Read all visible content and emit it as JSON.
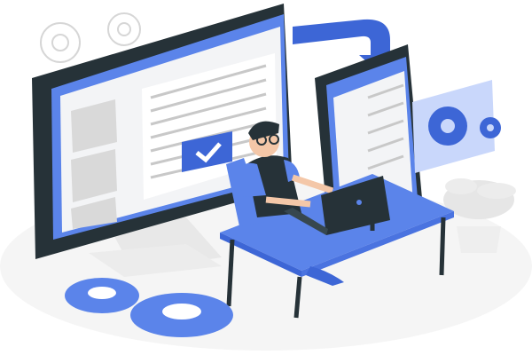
{
  "illustration": {
    "subject": "developer-at-laptop-with-monitor-and-phone",
    "colors": {
      "accent": "#5b84ea",
      "accent_dark": "#3d66d6",
      "accent_light": "#c9d7fb",
      "dark": "#263238",
      "screen": "#f3f4f6",
      "line": "#c8c8c8",
      "floor": "#f5f5f5"
    },
    "icons": [
      "gear-icon",
      "checkmark-icon",
      "arrow-icon",
      "plant-icon"
    ]
  }
}
